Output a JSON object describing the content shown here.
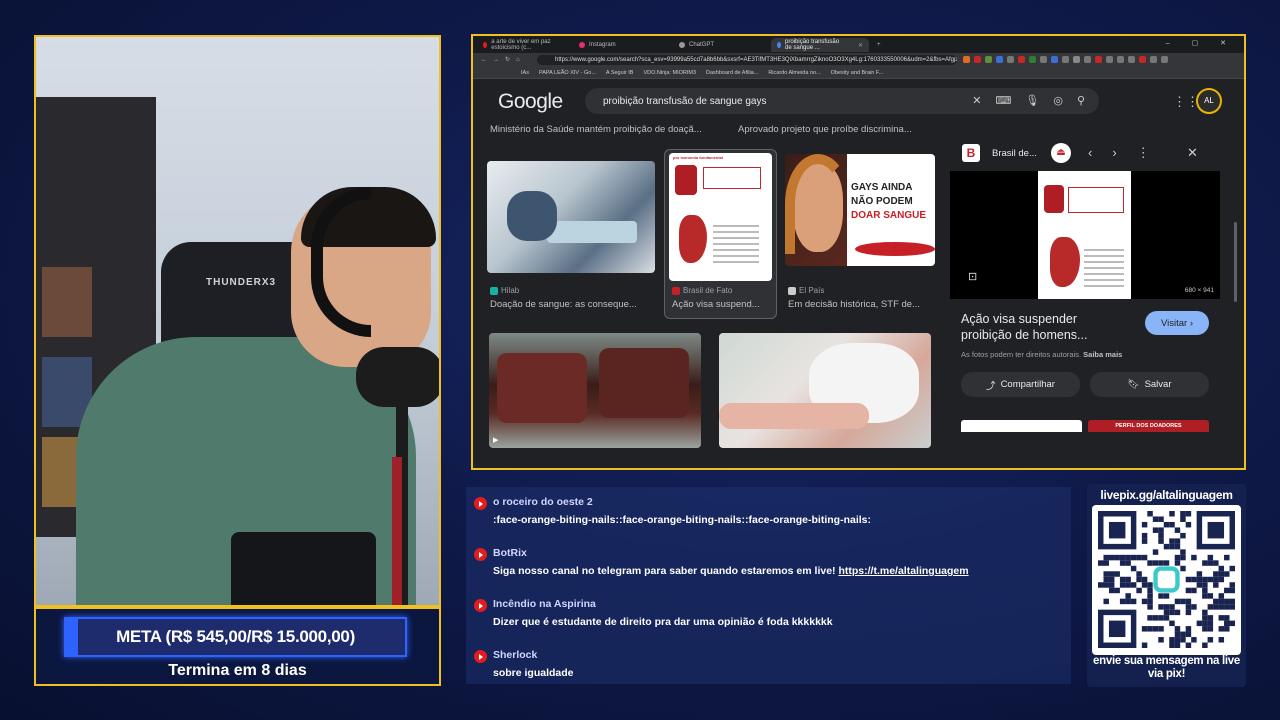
{
  "browser": {
    "tabs": [
      {
        "label": "a arte de viver em paz estoicismo (c...",
        "color": "#e31d1d",
        "active": false
      },
      {
        "label": "Instagram",
        "color": "#e1306c",
        "active": false
      },
      {
        "label": "ChatGPT",
        "color": "#999999",
        "active": false
      },
      {
        "label": "proibição transfusão de sangue ...",
        "color": "#4285f4",
        "active": true
      }
    ],
    "new_tab": "+",
    "window_controls": "–  ▢  ✕",
    "nav_glyphs": "←→↻⌂",
    "url": "https://www.google.com/search?sca_esv=93999a55cd7a8b6bb&sxsrf=AE3TifMT3HE3QiXbamrrgZiknoO3O3Xg4Lg:1760333550006&udm=2&fbs=AfgpHyUdUtNKr...",
    "bookmarks": [
      "IAs",
      "PAPA LEÃO XIV - Go...",
      "A Seguir IB",
      "VDO.Ninja: MIORIM3",
      "Dashboard de Afilia...",
      "Ricardo Almeida no...",
      "Obesity and Brain F..."
    ]
  },
  "google": {
    "logo": "Google",
    "query": "proibição transfusão de sangue gays",
    "clear_icon": "✕",
    "avatar": "AL",
    "top_captions": [
      "Ministério da Saúde mantém proibição de doaçã...",
      "Aprovado projeto que proíbe discrimina..."
    ],
    "results": [
      {
        "source": "Hilab",
        "caption": "Doação de sangue: as conseque..."
      },
      {
        "source": "Brasil de Fato",
        "caption": "Ação visa suspend..."
      },
      {
        "source": "El País",
        "caption": "Em decisão histórica, STF de..."
      }
    ],
    "poster_header": "por isonomia fundamental",
    "woman_text": [
      "GAYS AINDA",
      "NÃO PODEM",
      "DOAR SANGUE"
    ],
    "side": {
      "source": "Brasil de...",
      "logo_letter": "B",
      "dims": "680 × 941",
      "title": "Ação visa suspender proibição de homens...",
      "visit": "Visitar",
      "rights": "As fotos podem ter direitos autorais.",
      "rights_more": "Saiba mais",
      "share": "Compartilhar",
      "save": "Salvar",
      "related_label": "PERFIL DOS DOADORES"
    }
  },
  "goal": {
    "label": "META (R$ 545,00/R$ 15.000,00)",
    "progress_percent": 3.6,
    "ends": "Termina em 8 dias"
  },
  "chat": [
    {
      "author": "o roceiro do oeste 2",
      "text": ":face-orange-biting-nails::face-orange-biting-nails::face-orange-biting-nails:"
    },
    {
      "author": "BotRix",
      "text": "Siga nosso canal no telegram para saber quando estaremos em live! ",
      "link": "https://t.me/altalinguagem"
    },
    {
      "author": "Incêndio na Aspirina",
      "text": "Dizer que é estudante de direito pra dar uma opinião é foda kkkkkkk"
    },
    {
      "author": "Sherlock",
      "text": "sobre igualdade"
    }
  ],
  "pix": {
    "url": "livepix.gg/altalinguagem",
    "message": "envie sua mensagem na live via pix!"
  },
  "webcam": {
    "chair_brand": "THUNDERX3"
  },
  "colors": {
    "frame": "#f0c020",
    "goal_blue": "#2e63ff",
    "youtube_red": "#e31d1d",
    "visit_button": "#8ab4f8"
  }
}
